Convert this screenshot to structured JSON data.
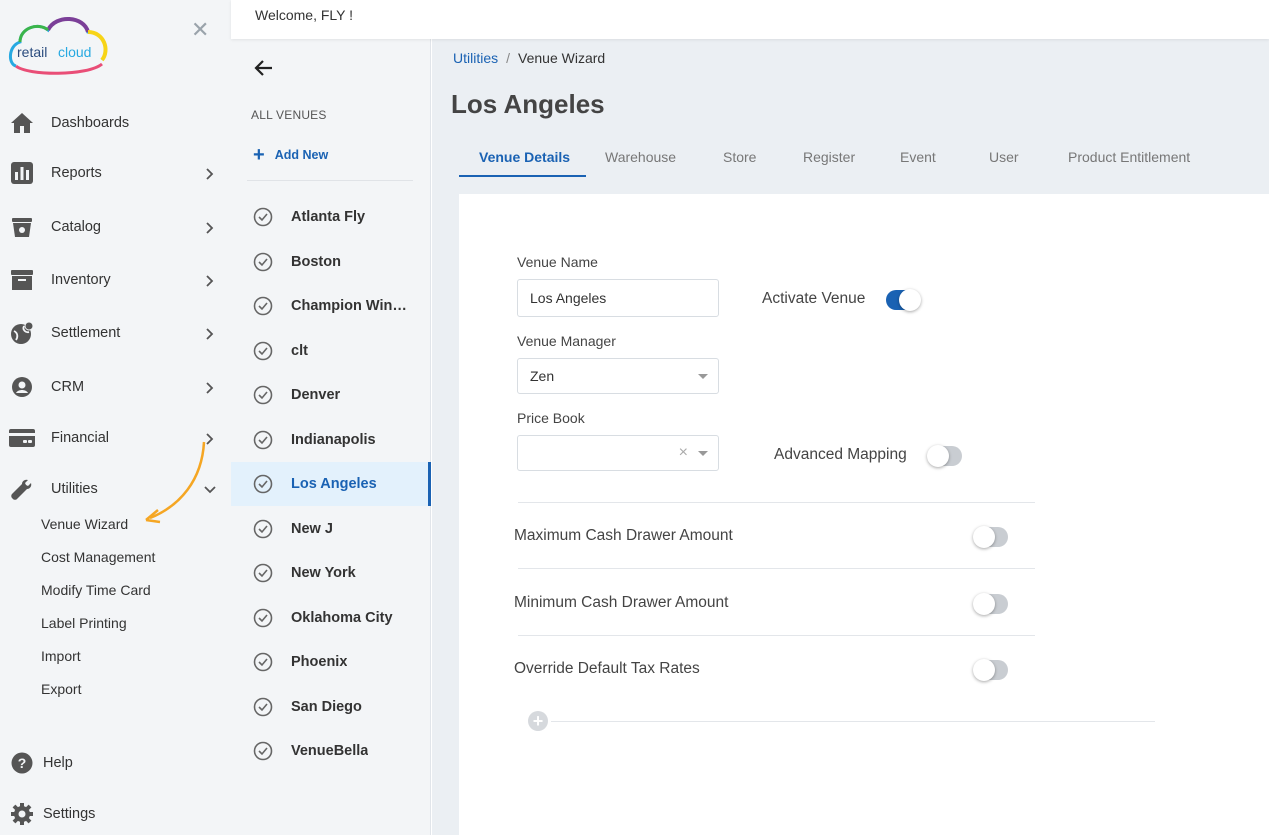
{
  "header": {
    "welcome": "Welcome, FLY !"
  },
  "brand": {
    "logo_text_a": "retail",
    "logo_text_b": "cloud"
  },
  "sidebar": {
    "items": [
      {
        "label": "Dashboards",
        "icon": "home-icon"
      },
      {
        "label": "Reports",
        "icon": "bar-chart-icon"
      },
      {
        "label": "Catalog",
        "icon": "catalog-icon"
      },
      {
        "label": "Inventory",
        "icon": "archive-icon"
      },
      {
        "label": "Settlement",
        "icon": "globe-icon"
      },
      {
        "label": "CRM",
        "icon": "user-circle-icon"
      },
      {
        "label": "Financial",
        "icon": "credit-card-icon"
      },
      {
        "label": "Utilities",
        "icon": "wrench-icon"
      }
    ],
    "sub_items": [
      "Venue Wizard",
      "Cost Management",
      "Modify Time Card",
      "Label Printing",
      "Import",
      "Export"
    ],
    "bottom": {
      "help": "Help",
      "settings": "Settings"
    }
  },
  "venues": {
    "heading": "ALL VENUES",
    "add_new": "Add New",
    "list": [
      "Atlanta Fly",
      "Boston",
      "Champion Wine …",
      "clt",
      "Denver",
      "Indianapolis",
      "Los Angeles",
      "New J",
      "New York",
      "Oklahoma City",
      "Phoenix",
      "San Diego",
      "VenueBella"
    ],
    "active": "Los Angeles"
  },
  "breadcrumb": {
    "parent": "Utilities",
    "separator": "/",
    "current": "Venue Wizard"
  },
  "page": {
    "title": "Los Angeles"
  },
  "tabs": [
    "Venue Details",
    "Warehouse",
    "Store",
    "Register",
    "Event",
    "User",
    "Product Entitlement"
  ],
  "form": {
    "venue_name_label": "Venue Name",
    "venue_name_value": "Los Angeles",
    "activate_label": "Activate Venue",
    "activate_on": true,
    "manager_label": "Venue Manager",
    "manager_value": "Zen",
    "price_book_label": "Price Book",
    "price_book_value": "",
    "price_book_clear": "×",
    "advanced_mapping_label": "Advanced Mapping",
    "advanced_mapping_on": false,
    "max_cash_label": "Maximum Cash Drawer Amount",
    "max_cash_on": false,
    "min_cash_label": "Minimum Cash Drawer Amount",
    "min_cash_on": false,
    "override_tax_label": "Override Default Tax Rates",
    "override_tax_on": false,
    "add_icon": "+"
  },
  "colors": {
    "accent": "#1a62b3",
    "arrow": "#f5a623",
    "sidebar_bg": "#f3f5f7",
    "main_bg": "#ebeff3"
  }
}
